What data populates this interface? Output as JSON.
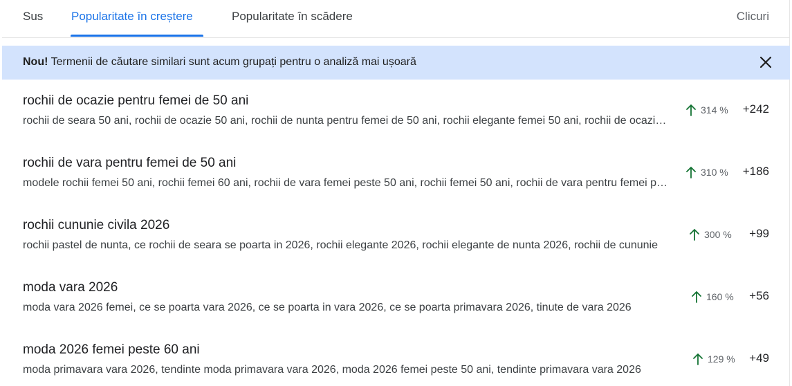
{
  "tabs": {
    "top": "Sus",
    "rising": "Popularitate în creștere",
    "falling": "Popularitate în scădere",
    "clicks": "Clicuri"
  },
  "banner": {
    "bold": "Nou!",
    "text": " Termenii de căutare similari sunt acum grupați pentru o analiză mai ușoară"
  },
  "colors": {
    "accent": "#1a73e8",
    "banner_bg": "#d3e3fd",
    "trend_up": "#137333"
  },
  "rows": [
    {
      "title": "rochii de ocazie pentru femei de 50 ani",
      "subtitle": "rochii de seara 50 ani, rochii de ocazie 50 ani, rochii de nunta pentru femei de 50 ani, rochii elegante femei 50 ani, rochii de ocazie pentru femei plinute",
      "trend": "314 %",
      "clicks": "+242"
    },
    {
      "title": "rochii de vara pentru femei de 50 ani",
      "subtitle": "modele rochii femei 50 ani, rochii femei 60 ani, rochii de vara femei peste 50 ani, rochii femei 50 ani, rochii de vara pentru femei plinute",
      "trend": "310 %",
      "clicks": "+186"
    },
    {
      "title": "rochii cununie civila 2026",
      "subtitle": "rochii pastel de nunta, ce rochii de seara se poarta in 2026, rochii elegante 2026, rochii elegante de nunta 2026, rochii de cununie",
      "trend": "300 %",
      "clicks": "+99"
    },
    {
      "title": "moda vara 2026",
      "subtitle": "moda vara 2026 femei, ce se poarta vara 2026, ce se poarta in vara 2026, ce se poarta primavara 2026, tinute de vara 2026",
      "trend": "160 %",
      "clicks": "+56"
    },
    {
      "title": "moda 2026 femei peste 60 ani",
      "subtitle": "moda primavara vara 2026, tendinte moda primavara vara 2026, moda 2026 femei peste 50 ani, tendinte primavara vara 2026",
      "trend": "129 %",
      "clicks": "+49"
    }
  ]
}
